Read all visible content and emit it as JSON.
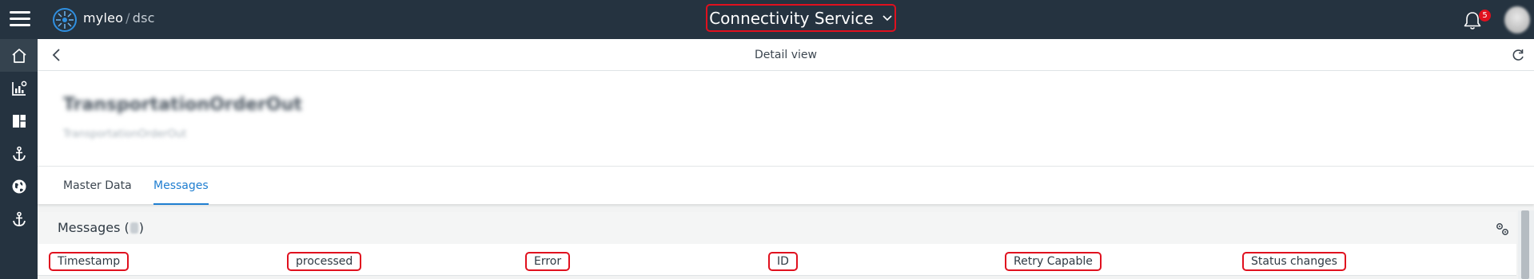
{
  "topbar": {
    "brand": "myleo",
    "brand_separator": "/",
    "app_name": "dsc",
    "service_title": "Connectivity Service",
    "notification_count": "5"
  },
  "nav": {
    "items": [
      {
        "icon": "home-icon"
      },
      {
        "icon": "analytics-icon"
      },
      {
        "icon": "dashboard-icon"
      },
      {
        "icon": "anchor-icon"
      },
      {
        "icon": "globe-icon"
      },
      {
        "icon": "anchor-icon"
      }
    ]
  },
  "detail": {
    "title": "Detail view",
    "object_name": "TransportationOrderOut",
    "object_subtitle": "TransportationOrderOut"
  },
  "tabs": [
    {
      "label": "Master Data",
      "active": false
    },
    {
      "label": "Messages",
      "active": true
    }
  ],
  "messages": {
    "title": "Messages (",
    "title_close": ")",
    "columns": [
      "Timestamp",
      "processed",
      "Error",
      "ID",
      "Retry Capable",
      "Status changes"
    ]
  },
  "colors": {
    "topbar_bg": "#253340",
    "accent": "#1f7ed0",
    "highlight": "#e0101e"
  }
}
